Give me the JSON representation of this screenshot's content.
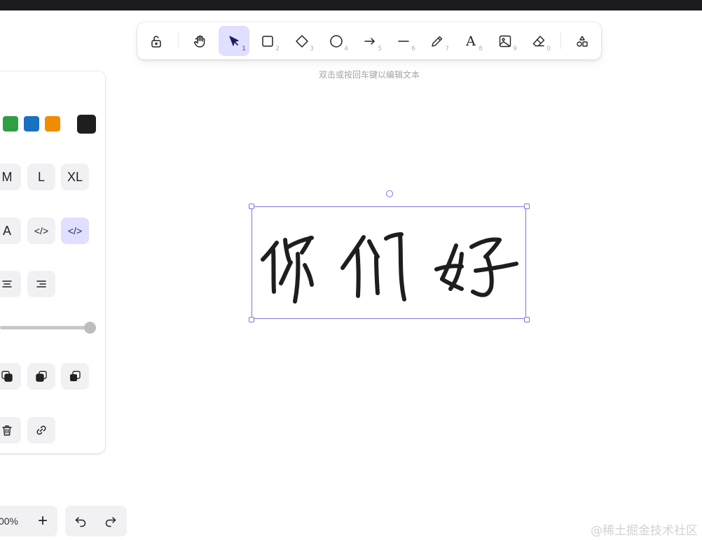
{
  "toolbar": {
    "tools": [
      {
        "name": "lock",
        "key": ""
      },
      {
        "name": "hand",
        "key": ""
      },
      {
        "name": "selection",
        "key": "1"
      },
      {
        "name": "rectangle",
        "key": "2"
      },
      {
        "name": "diamond",
        "key": "3"
      },
      {
        "name": "ellipse",
        "key": "4"
      },
      {
        "name": "arrow",
        "key": "5"
      },
      {
        "name": "line",
        "key": "6"
      },
      {
        "name": "pencil",
        "key": "7"
      },
      {
        "name": "text",
        "key": "8"
      },
      {
        "name": "image",
        "key": "9"
      },
      {
        "name": "eraser",
        "key": "0"
      },
      {
        "name": "more-shapes",
        "key": ""
      }
    ],
    "selected_tool": "selection",
    "text_glyph": "A"
  },
  "hint": "双击或按回车键以编辑文本",
  "panel": {
    "stroke_colors": [
      "#2f9e44",
      "#1971c2",
      "#f08c00"
    ],
    "current_color": "#1e1e1e",
    "font_sizes": [
      "M",
      "L",
      "XL"
    ],
    "font_family_label": "A",
    "code_label": "</>",
    "opacity_value": 100
  },
  "zoom": {
    "label": "00%",
    "plus": "+"
  },
  "accent": "#7b77dd",
  "watermark": "@稀土掘金技术社区"
}
